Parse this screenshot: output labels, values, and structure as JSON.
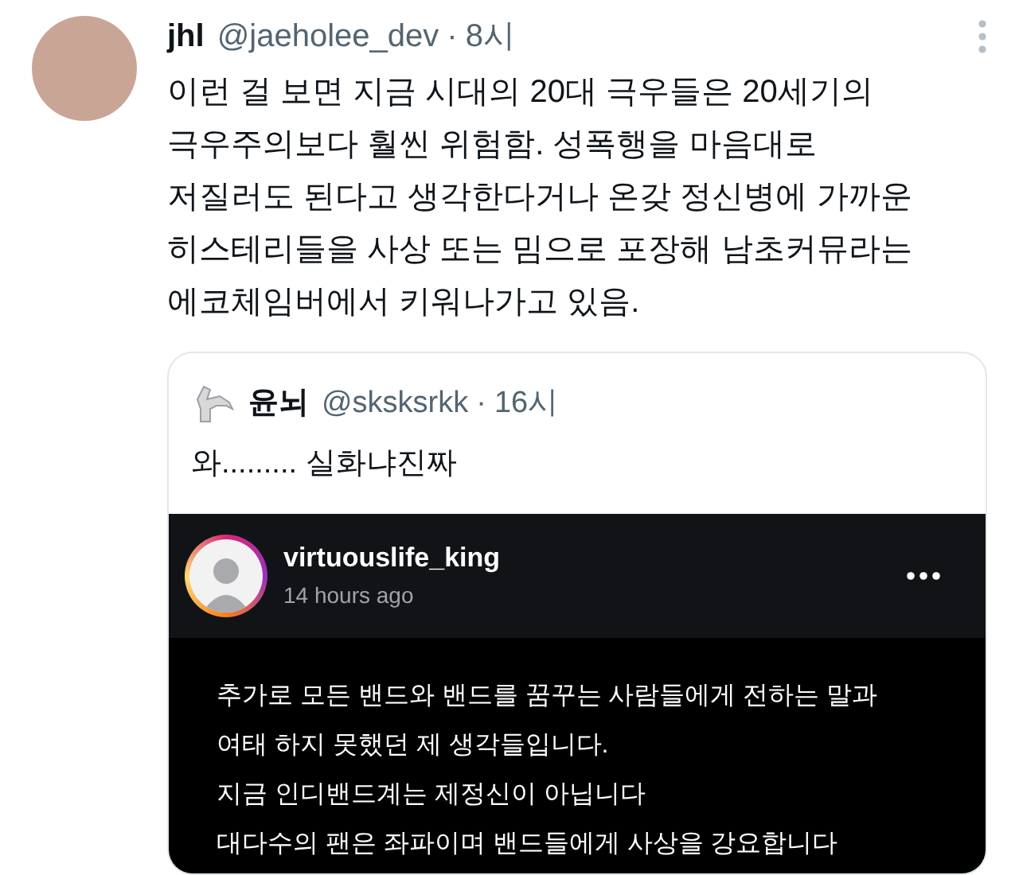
{
  "tweet": {
    "display_name": "jhl",
    "handle": "@jaeholee_dev",
    "separator": "·",
    "time": "8시",
    "text": "이런 걸 보면 지금 시대의 20대 극우들은 20세기의\n극우주의보다 훨씬 위험함. 성폭행을 마음대로\n저질러도 된다고 생각한다거나 온갖 정신병에 가까운\n히스테리들을 사상 또는 밈으로 포장해 남초커뮤라는\n에코체임버에서 키워나가고 있음."
  },
  "quoted_tweet": {
    "display_name": "윤뇌",
    "handle": "@sksksrkk",
    "separator": "·",
    "time": "16시",
    "text": "와......... 실화냐진짜",
    "embedded_post": {
      "username": "virtuouslife_king",
      "time": "14 hours ago",
      "lines": [
        "추가로 모든 밴드와 밴드를 꿈꾸는 사람들에게 전하는 말과",
        "여태 하지 못했던 제 생각들입니다.",
        "지금 인디밴드계는 제정신이 아닙니다",
        "대다수의 팬은 좌파이며 밴드들에게 사상을 강요합니다"
      ]
    }
  }
}
